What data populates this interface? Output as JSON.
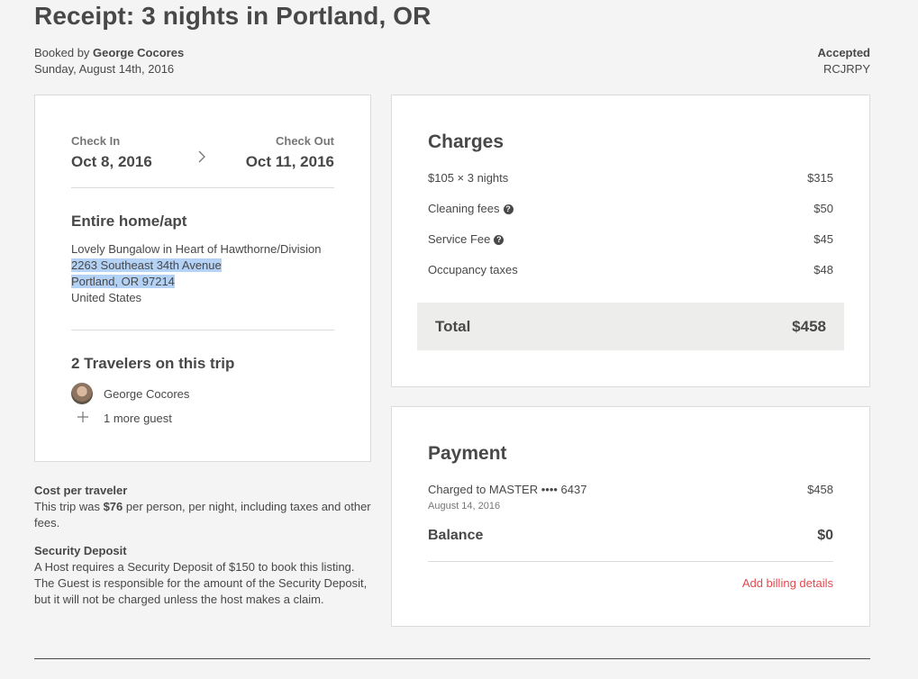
{
  "receipt": {
    "title": "Receipt: 3 nights in Portland, OR",
    "booked_by_prefix": "Booked by ",
    "booked_by_name": "George Cocores",
    "booked_date": "Sunday, August 14th, 2016",
    "status": "Accepted",
    "confirmation_code": "RCJRPY"
  },
  "trip": {
    "check_in_label": "Check In",
    "check_in_date": "Oct 8, 2016",
    "check_out_label": "Check Out",
    "check_out_date": "Oct 11, 2016",
    "room_type": "Entire home/apt",
    "listing_name": "Lovely Bungalow in Heart of Hawthorne/Division",
    "address_line1": "2263 Southeast 34th Avenue",
    "address_line2": "Portland, OR 97214",
    "country": "United States",
    "travelers_heading": "2 Travelers on this trip",
    "traveler_name": "George Cocores",
    "more_guests": "1 more guest"
  },
  "charges": {
    "heading": "Charges",
    "rows": [
      {
        "label": "$105 × 3 nights",
        "amount": "$315"
      },
      {
        "label": "Cleaning fees",
        "amount": "$50"
      },
      {
        "label": "Service Fee",
        "amount": "$45"
      },
      {
        "label": "Occupancy taxes",
        "amount": "$48"
      }
    ],
    "total_label": "Total",
    "total_amount": "$458"
  },
  "payment": {
    "heading": "Payment",
    "charged_to": "Charged to MASTER •••• 6437",
    "charged_date": "August 14, 2016",
    "charged_amount": "$458",
    "balance_label": "Balance",
    "balance_amount": "$0",
    "add_billing_link": "Add billing details"
  },
  "notes": {
    "cost_heading": "Cost per traveler",
    "cost_prefix": "This trip was ",
    "cost_value": "$76",
    "cost_suffix": " per person, per night, including taxes and other fees.",
    "deposit_heading": "Security Deposit",
    "deposit_text": "A Host requires a Security Deposit of $150 to book this listing. The Guest is responsible for the amount of the Security Deposit, but it will not be charged unless the host makes a claim."
  },
  "colors": {
    "text": "#484848",
    "link": "#e5484d",
    "highlight": "#b4d2f5",
    "total_band": "#ededeb"
  }
}
